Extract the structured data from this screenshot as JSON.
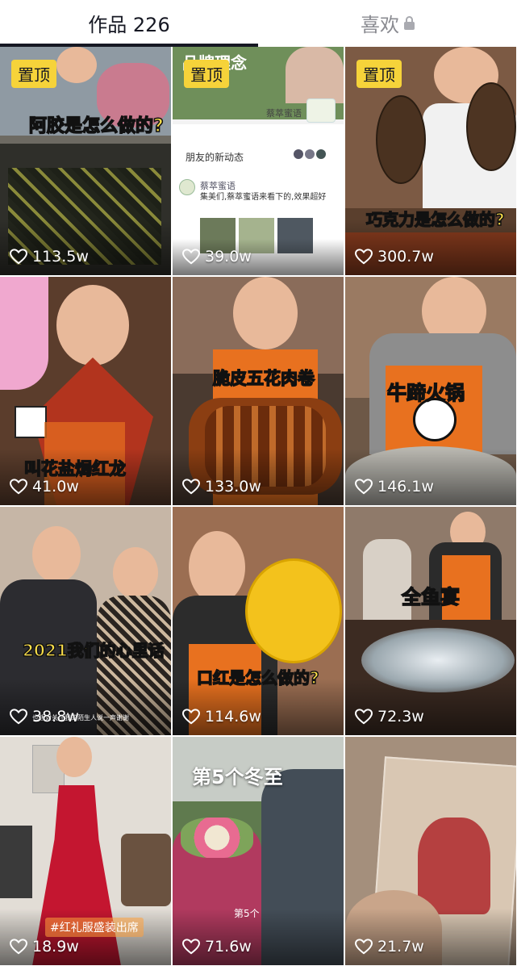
{
  "tabs": {
    "works_label": "作品 226",
    "likes_label": "喜欢"
  },
  "icons": {
    "like": "heart-outline-icon",
    "lock": "lock-icon"
  },
  "colors": {
    "pin_bg": "#f6d33a",
    "caption": "#ffe14a",
    "apron": "#e8711f",
    "active_tab": "#161823",
    "inactive_tab": "#8a8b91"
  },
  "videos": [
    {
      "pinned": "置顶",
      "caption": "阿胶是怎么做的?",
      "likes": "113.5w"
    },
    {
      "pinned": "置顶",
      "caption": "",
      "likes": "39.0w",
      "overlay": {
        "brand": "品牌理念",
        "account": "蔡萃蜜语",
        "feed_title": "朋友的新动态",
        "post_author": "蔡萃蜜语",
        "post_text": "集美们,蔡萃蜜语来看下的,效果超好"
      }
    },
    {
      "pinned": "置顶",
      "caption": "巧克力是怎么做的?",
      "likes": "300.7w"
    },
    {
      "caption": "叫花盐焗红龙",
      "likes": "41.0w"
    },
    {
      "caption": "脆皮五花肉卷",
      "likes": "133.0w"
    },
    {
      "caption": "牛蹄火锅",
      "likes": "146.1w"
    },
    {
      "caption": "2021我们的心里话",
      "likes": "38.8w",
      "subtitle": "也想对关注我的陌生人说一声谢谢"
    },
    {
      "caption": "口红是怎么做的?",
      "likes": "114.6w"
    },
    {
      "caption": "全鱼宴",
      "likes": "72.3w"
    },
    {
      "caption": "#红礼服盛装出席",
      "likes": "18.9w"
    },
    {
      "caption": "第5个冬至",
      "likes": "71.6w",
      "subtitle": "第5个"
    },
    {
      "caption": "",
      "likes": "21.7w"
    }
  ]
}
